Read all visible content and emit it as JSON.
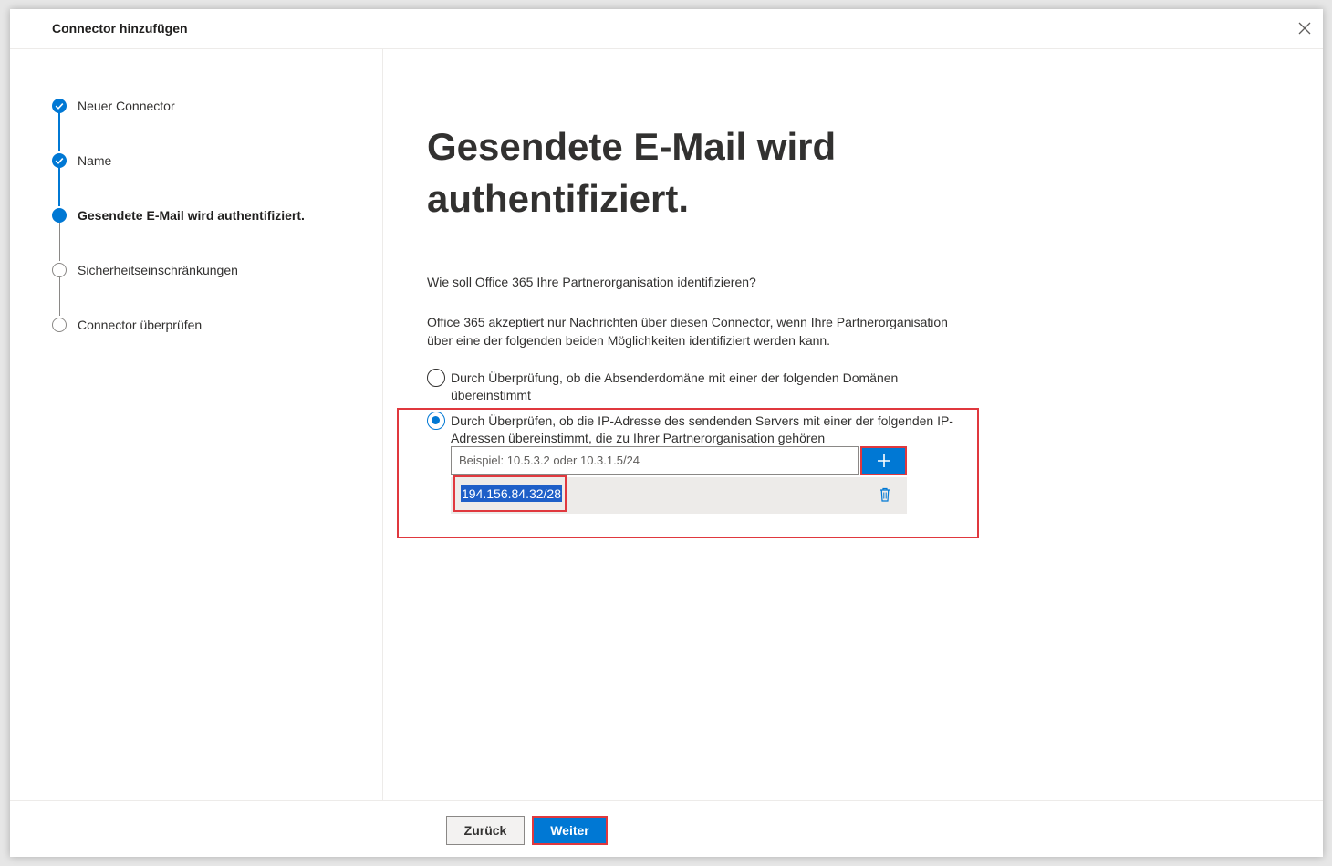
{
  "dialog": {
    "title": "Connector hinzufügen",
    "close_icon": "close-icon"
  },
  "steps": [
    {
      "label": "Neuer Connector",
      "state": "done"
    },
    {
      "label": "Name",
      "state": "done"
    },
    {
      "label": "Gesendete E-Mail wird authentifiziert.",
      "state": "current"
    },
    {
      "label": "Sicherheitseinschränkungen",
      "state": "todo"
    },
    {
      "label": "Connector überprüfen",
      "state": "todo"
    }
  ],
  "main": {
    "heading": "Gesendete E-Mail wird authentifiziert.",
    "question": "Wie soll Office 365 Ihre Partnerorganisation identifizieren?",
    "description": "Office 365 akzeptiert nur Nachrichten über diesen Connector, wenn Ihre Partnerorganisation über eine der folgenden beiden Möglichkeiten identifiziert werden kann.",
    "options": [
      {
        "label": "Durch Überprüfung, ob die Absenderdomäne mit einer der folgenden Domänen übereinstimmt",
        "checked": false
      },
      {
        "label": "Durch Überprüfen, ob die IP-Adresse des sendenden Servers mit einer der folgenden IP-Adressen übereinstimmt, die zu Ihrer Partnerorganisation gehören",
        "checked": true
      }
    ],
    "ip_input": {
      "value": "",
      "placeholder": "Beispiel: 10.5.3.2 oder 10.3.1.5/24"
    },
    "ip_list": [
      "194.156.84.32/28"
    ]
  },
  "footer": {
    "back_label": "Zurück",
    "next_label": "Weiter"
  },
  "colors": {
    "accent": "#0078d4",
    "highlight": "#e0383e"
  }
}
